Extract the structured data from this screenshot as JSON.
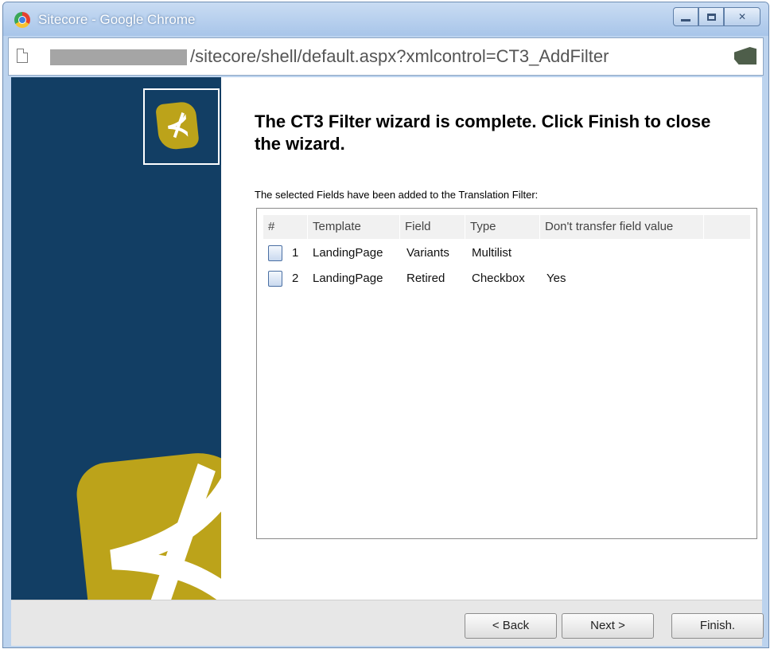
{
  "window": {
    "title": "Sitecore - Google Chrome",
    "url_path": "/sitecore/shell/default.aspx?xmlcontrol=CT3_AddFilter"
  },
  "icons": {
    "app": "chrome-logo-icon",
    "page": "page-icon",
    "extension": "extension-icon",
    "minimize": "minimize-icon",
    "maximize": "maximize-icon",
    "close": "close-icon",
    "logo": "sitecore-logo-icon",
    "row": "document-icon"
  },
  "colors": {
    "sidebar": "#123e64",
    "logo": "#bca31a"
  },
  "wizard": {
    "heading": "The CT3 Filter wizard is complete. Click Finish to close the wizard.",
    "subtext": "The selected Fields have been added to the Translation Filter:",
    "logo_glyph": "⊀"
  },
  "table": {
    "columns": [
      "#",
      "Template",
      "Field",
      "Type",
      "Don't transfer field value"
    ],
    "rows": [
      {
        "num": "1",
        "template": "LandingPage",
        "field": "Variants",
        "type": "Multilist",
        "dont_transfer": ""
      },
      {
        "num": "2",
        "template": "LandingPage",
        "field": "Retired",
        "type": "Checkbox",
        "dont_transfer": "Yes"
      }
    ]
  },
  "buttons": {
    "back": "< Back",
    "next": "Next >",
    "finish": "Finish.",
    "close_glyph": "✕"
  }
}
